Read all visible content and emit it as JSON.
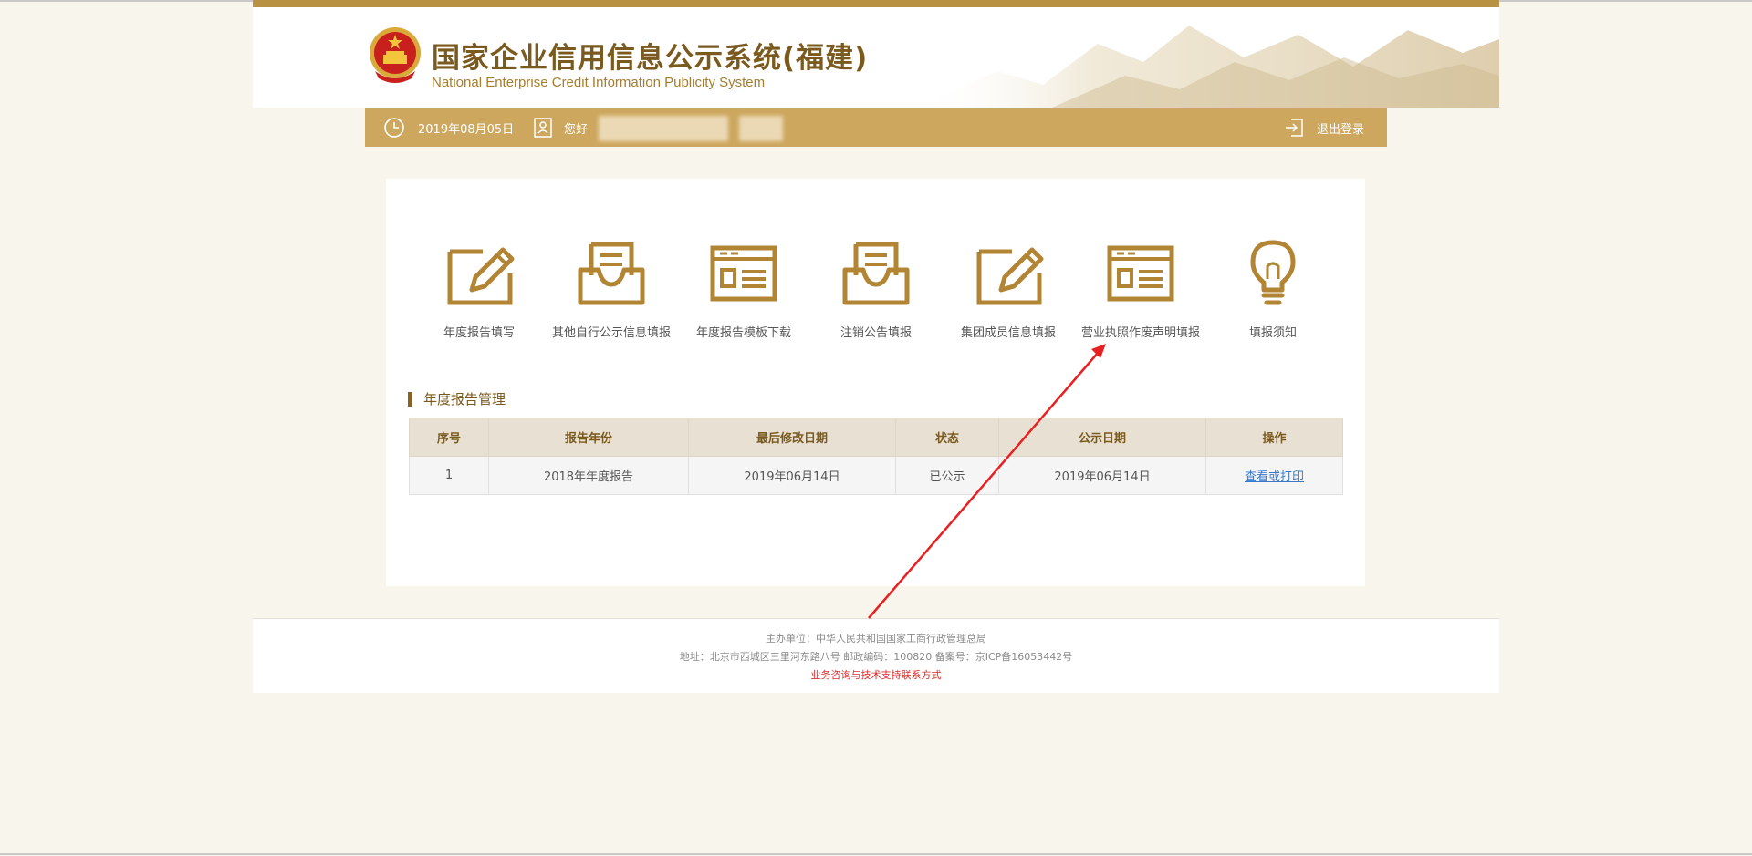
{
  "header": {
    "title_cn": "国家企业信用信息公示系统(福建)",
    "title_en": "National Enterprise Credit Information Publicity System"
  },
  "infobar": {
    "date": "2019年08月05日",
    "greeting": "您好",
    "logout": "退出登录"
  },
  "menu": [
    {
      "label": "年度报告填写",
      "icon": "edit-icon"
    },
    {
      "label": "其他自行公示信息填报",
      "icon": "inbox-icon"
    },
    {
      "label": "年度报告模板下载",
      "icon": "browser-window-icon"
    },
    {
      "label": "注销公告填报",
      "icon": "inbox-icon"
    },
    {
      "label": "集团成员信息填报",
      "icon": "edit-icon"
    },
    {
      "label": "营业执照作废声明填报",
      "icon": "browser-window-icon"
    },
    {
      "label": "填报须知",
      "icon": "lightbulb-icon"
    }
  ],
  "section": {
    "title": "年度报告管理"
  },
  "table": {
    "headers": [
      "序号",
      "报告年份",
      "最后修改日期",
      "状态",
      "公示日期",
      "操作"
    ],
    "rows": [
      [
        "1",
        "2018年年度报告",
        "2019年06月14日",
        "已公示",
        "2019年06月14日",
        "查看或打印"
      ]
    ]
  },
  "footer": {
    "line1": "主办单位：中华人民共和国国家工商行政管理总局",
    "line2": "地址：北京市西城区三里河东路八号 邮政编码：100820 备案号：京ICP备16053442号",
    "contact": "业务咨询与技术支持联系方式"
  },
  "colors": {
    "gold": "#b89142",
    "infobar": "#cda75e",
    "icon": "#b28535",
    "link": "#3a79c9",
    "annotation": "#e82020"
  }
}
